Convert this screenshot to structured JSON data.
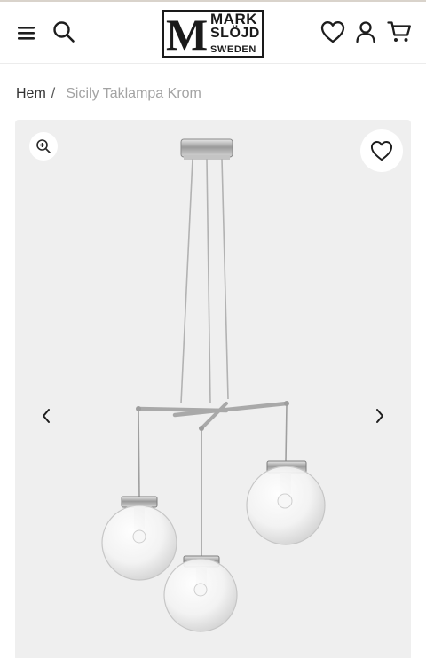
{
  "header": {
    "logo": {
      "letter": "M",
      "line1": "MARK",
      "line2": "SLÖJD",
      "line3": "SWEDEN"
    },
    "icons": [
      "menu-icon",
      "search-icon",
      "heart-icon",
      "user-icon",
      "cart-icon"
    ]
  },
  "breadcrumb": {
    "home": "Hem",
    "separator": "/",
    "current": "Sicily Taklampa Krom"
  },
  "gallery": {
    "icons": [
      "zoom-in-icon",
      "heart-icon",
      "chevron-left-icon",
      "chevron-right-icon"
    ],
    "background": "#efefef"
  },
  "colors": {
    "text": "#222222",
    "breadcrumb_current": "#a3a3a3",
    "gallery_bg": "#efefef",
    "chrome": "#b8b8b8"
  }
}
